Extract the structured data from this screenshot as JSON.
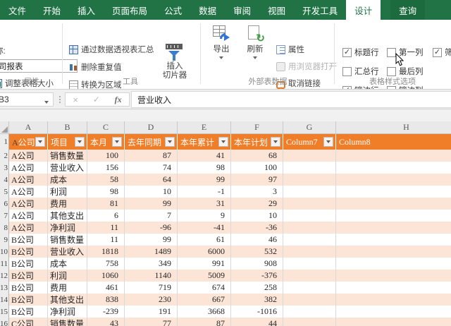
{
  "tabs": [
    {
      "label": "文件"
    },
    {
      "label": "开始"
    },
    {
      "label": "插入"
    },
    {
      "label": "页面布局"
    },
    {
      "label": "公式"
    },
    {
      "label": "数据"
    },
    {
      "label": "审阅"
    },
    {
      "label": "视图"
    },
    {
      "label": "开发工具"
    },
    {
      "label": "设计",
      "active": true
    },
    {
      "label": "查询",
      "contextual": true
    }
  ],
  "ribbon": {
    "properties_group": {
      "label": "属性",
      "table_name_label": "表名称:",
      "table_name_value": "各公司报表",
      "resize_button": "调整表格大小"
    },
    "tools_group": {
      "label": "工具",
      "items": [
        "通过数据透视表汇总",
        "删除重复值",
        "转换为区域"
      ],
      "slicer_line1": "插入",
      "slicer_line2": "切片器"
    },
    "external_group": {
      "label": "外部表数据",
      "export": "导出",
      "refresh": "刷新",
      "properties": "属性",
      "open_in_browser": "用浏览器打开",
      "unlink": "取消链接"
    },
    "style_options_group": {
      "label": "表格样式选项",
      "columns": [
        [
          {
            "label": "标题行",
            "checked": true
          },
          {
            "label": "汇总行",
            "checked": false
          },
          {
            "label": "镶边行",
            "checked": true
          }
        ],
        [
          {
            "label": "第一列",
            "checked": false
          },
          {
            "label": "最后列",
            "checked": false
          },
          {
            "label": "镶边列",
            "checked": false
          }
        ],
        [
          {
            "label": "筛选按钮",
            "checked": true
          }
        ]
      ]
    }
  },
  "formula_bar": {
    "name_box": "B3",
    "formula": "营业收入"
  },
  "grid": {
    "column_letters": [
      "A",
      "B",
      "C",
      "D",
      "E",
      "F",
      "G",
      "H"
    ],
    "header_row": [
      "A公司",
      "项目",
      "本月",
      "去年同期",
      "本年累计",
      "本年计划",
      "Column7",
      "Column8"
    ],
    "rows": [
      {
        "n": "2",
        "company": "A公司",
        "item": "销售数量",
        "values": [
          "100",
          "87",
          "41",
          "68"
        ]
      },
      {
        "n": "3",
        "company": "A公司",
        "item": "营业收入",
        "values": [
          "156",
          "74",
          "98",
          "100"
        ]
      },
      {
        "n": "4",
        "company": "A公司",
        "item": "成本",
        "values": [
          "58",
          "64",
          "99",
          "97"
        ]
      },
      {
        "n": "5",
        "company": "A公司",
        "item": "利润",
        "values": [
          "98",
          "10",
          "-1",
          "3"
        ]
      },
      {
        "n": "6",
        "company": "A公司",
        "item": "费用",
        "values": [
          "81",
          "99",
          "31",
          "29"
        ]
      },
      {
        "n": "7",
        "company": "A公司",
        "item": "其他支出",
        "values": [
          "6",
          "7",
          "9",
          "10"
        ]
      },
      {
        "n": "8",
        "company": "A公司",
        "item": "净利润",
        "values": [
          "11",
          "-96",
          "-41",
          "-36"
        ]
      },
      {
        "n": "9",
        "company": "B公司",
        "item": "销售数量",
        "values": [
          "11",
          "99",
          "61",
          "46"
        ]
      },
      {
        "n": "10",
        "company": "B公司",
        "item": "营业收入",
        "values": [
          "1818",
          "1489",
          "6000",
          "532"
        ]
      },
      {
        "n": "11",
        "company": "B公司",
        "item": "成本",
        "values": [
          "758",
          "349",
          "991",
          "908"
        ]
      },
      {
        "n": "12",
        "company": "B公司",
        "item": "利润",
        "values": [
          "1060",
          "1140",
          "5009",
          "-376"
        ]
      },
      {
        "n": "13",
        "company": "B公司",
        "item": "费用",
        "values": [
          "461",
          "719",
          "674",
          "258"
        ]
      },
      {
        "n": "14",
        "company": "B公司",
        "item": "其他支出",
        "values": [
          "838",
          "230",
          "667",
          "382"
        ]
      },
      {
        "n": "15",
        "company": "B公司",
        "item": "净利润",
        "values": [
          "-239",
          "191",
          "3668",
          "-1016"
        ]
      },
      {
        "n": "16",
        "company": "C公司",
        "item": "销售数量",
        "values": [
          "43",
          "77",
          "87",
          "44"
        ]
      }
    ]
  },
  "colors": {
    "excel_green": "#217346",
    "table_header_orange": "#F07E29",
    "banded_row": "#FCE4D6",
    "gridline": "#D9D9D9"
  }
}
